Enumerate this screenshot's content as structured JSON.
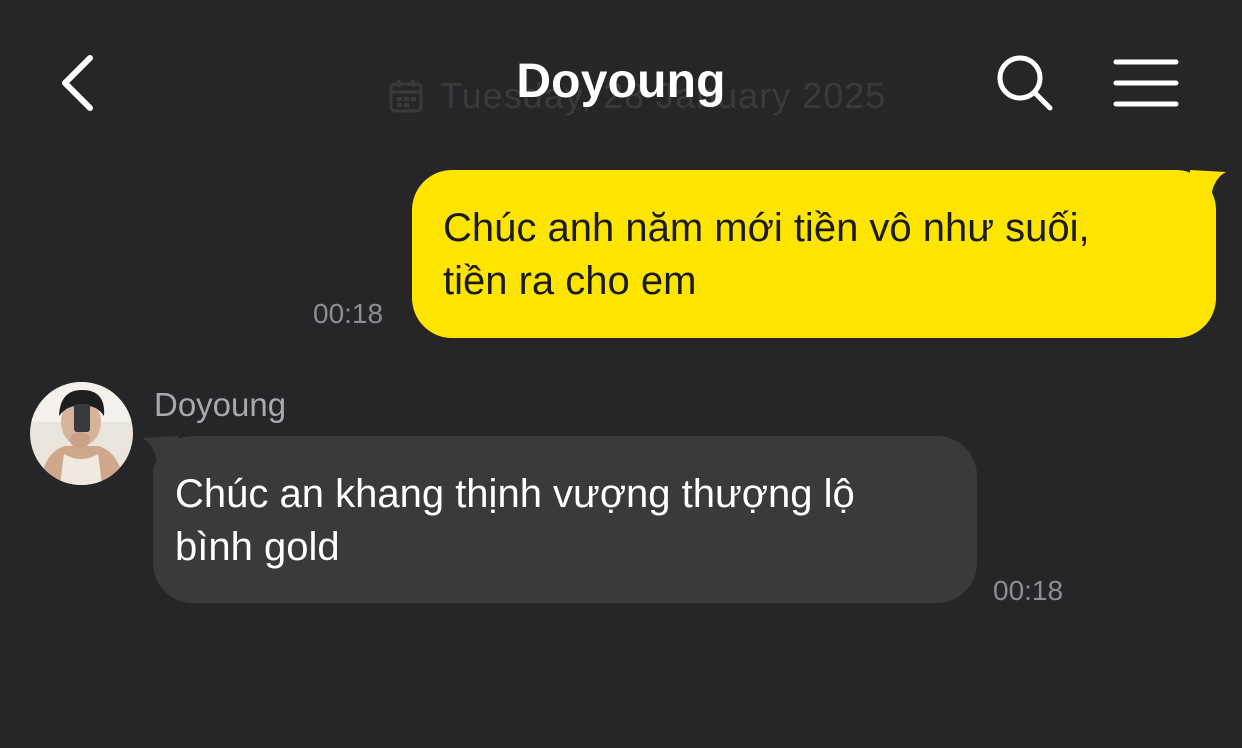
{
  "header": {
    "title": "Doyoung",
    "date_behind": "Tuesday, 28 January 2025",
    "back_icon": "chevron-left-icon",
    "search_icon": "search-icon",
    "menu_icon": "hamburger-menu-icon"
  },
  "messages": [
    {
      "direction": "sent",
      "lines": [
        "Chúc anh năm mới tiền vô như suối,",
        "tiền ra cho em"
      ],
      "time": "00:18"
    },
    {
      "direction": "received",
      "sender": "Doyoung",
      "lines": [
        "Chúc an khang thịnh vượng thượng lộ",
        "bình gold"
      ],
      "time": "00:18"
    }
  ],
  "colors": {
    "background": "#262628",
    "sent_bubble": "#fee500",
    "received_bubble": "#3a3a3c",
    "timestamp": "#8d8d92"
  }
}
